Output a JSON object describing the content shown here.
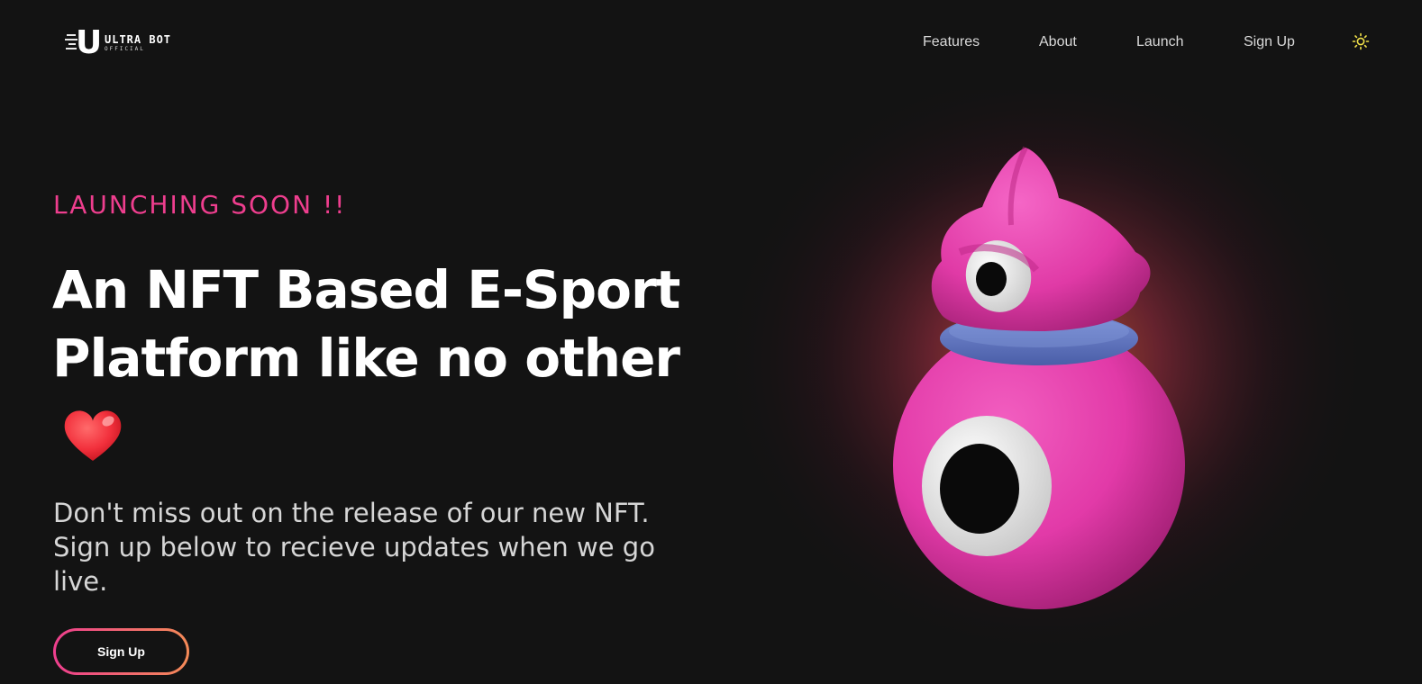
{
  "header": {
    "logo": {
      "mark": "U",
      "name": "ULTRA BOT",
      "subtitle": "OFFICIAL"
    },
    "nav": [
      {
        "label": "Features"
      },
      {
        "label": "About"
      },
      {
        "label": "Launch"
      },
      {
        "label": "Sign Up"
      }
    ],
    "theme_toggle_icon": "sun-icon"
  },
  "hero": {
    "eyebrow": "LAUNCHING SOON !!",
    "headline_line1": "An NFT Based E-Sport",
    "headline_line2": "Platform like no other",
    "emoji_icon": "heart-icon",
    "subtext": "Don't miss out on the release of our new NFT. Sign up below to recieve updates when we go live.",
    "cta_label": "Sign Up",
    "illustration": "pink-robot-mascot"
  },
  "colors": {
    "background": "#131313",
    "accent_pink": "#ee3e8e",
    "accent_orange": "#f58b57",
    "text": "#ffffff",
    "muted_text": "#d6d6d6",
    "sun_icon": "#f4e44a"
  }
}
